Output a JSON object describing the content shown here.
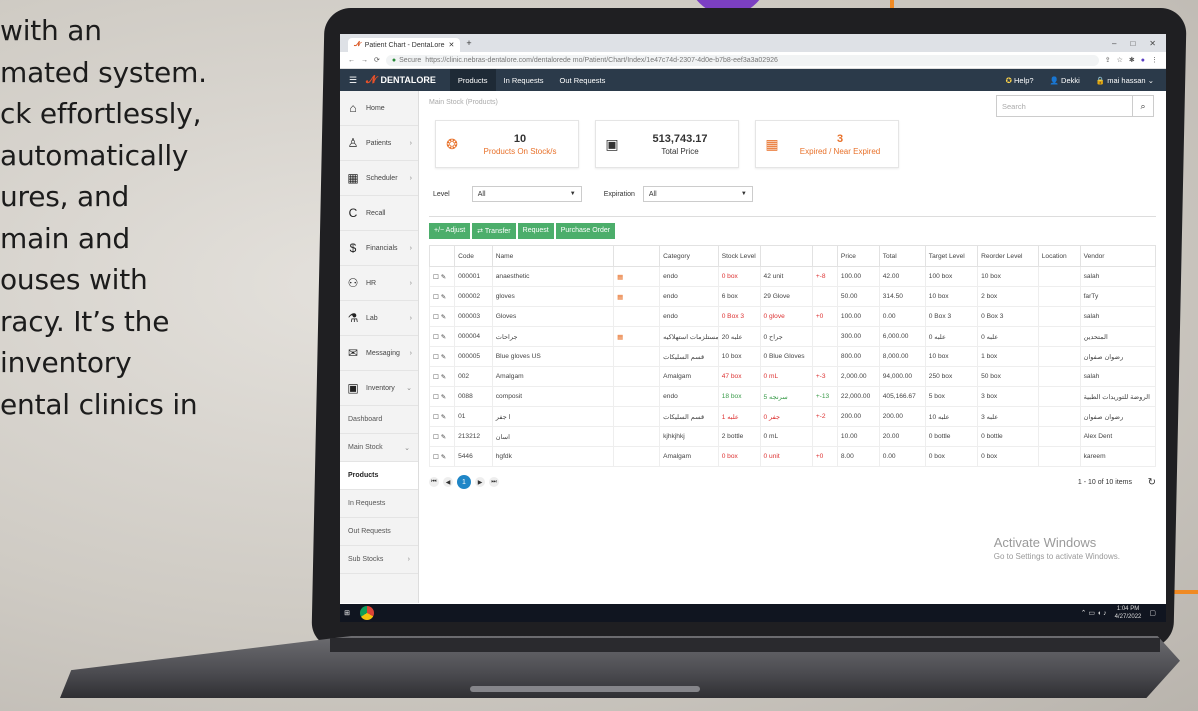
{
  "promo": {
    "lines": [
      "with an",
      "mated system.",
      "ck effortlessly,",
      "automatically",
      "ures, and",
      "main and",
      "ouses with",
      "racy. It’s the",
      "inventory",
      "ental clinics in"
    ]
  },
  "browser": {
    "tab_title": "Patient Chart - DentaLore",
    "new_tab": "+",
    "win_controls": [
      "–",
      "□",
      "✕"
    ],
    "secure": "Secure",
    "url": "https://clinic.nebras-dentalore.com/dentalorede mo/Patient/Chart/Index/1e47c74d-2307-4d0e-b7b8-eef3a3a02926"
  },
  "app": {
    "brand": "DENTALORE",
    "nav": [
      "Products",
      "In Requests",
      "Out Requests"
    ],
    "help": "Help?",
    "user1": "Dekki",
    "user2": "mai hassan",
    "breadcrumb": "Main Stock (Products)",
    "search_placeholder": "Search"
  },
  "sidebar": {
    "items": [
      {
        "label": "Home",
        "icon": "home-icon"
      },
      {
        "label": "Patients",
        "icon": "person-icon"
      },
      {
        "label": "Scheduler",
        "icon": "calendar-icon"
      },
      {
        "label": "Recall",
        "icon": "recall-icon"
      },
      {
        "label": "Financials",
        "icon": "dollar-icon"
      },
      {
        "label": "HR",
        "icon": "group-icon"
      },
      {
        "label": "Lab",
        "icon": "flask-icon"
      },
      {
        "label": "Messaging",
        "icon": "envelope-icon"
      },
      {
        "label": "Inventory",
        "icon": "box-icon"
      }
    ],
    "subitems": [
      "Dashboard",
      "Main Stock",
      "Products",
      "In Requests",
      "Out Requests",
      "Sub Stocks"
    ]
  },
  "cards": [
    {
      "value": "10",
      "label": "Products On Stock/s"
    },
    {
      "value": "513,743.17",
      "label": "Total Price"
    },
    {
      "value": "3",
      "label": "Expired / Near Expired"
    }
  ],
  "filters": {
    "level_label": "Level",
    "level_value": "All",
    "expiration_label": "Expiration",
    "expiration_value": "All"
  },
  "actions": [
    "+/− Adjust",
    "⇄ Transfer",
    "Request",
    "Purchase Order"
  ],
  "table": {
    "headers": [
      "",
      "Code",
      "Name",
      "",
      "Category",
      "Stock Level",
      "",
      "",
      "Price",
      "Total",
      "Target Level",
      "Reorder Level",
      "Location",
      "Vendor"
    ],
    "rows": [
      {
        "code": "000001",
        "name": "anaesthetic",
        "cal": true,
        "category": "endo",
        "s1": "0 box",
        "s2": "42 unit",
        "s3": "+-8",
        "price": "100.00",
        "total": "42.00",
        "target": "100 box",
        "reorder": "10 box",
        "location": "",
        "vendor": "salah"
      },
      {
        "code": "000002",
        "name": "gloves",
        "cal": true,
        "category": "endo",
        "s1": "6 box",
        "s2": "29 Glove",
        "s3": "",
        "price": "50.00",
        "total": "314.50",
        "target": "10 box",
        "reorder": "2 box",
        "location": "",
        "vendor": "farTy"
      },
      {
        "code": "000003",
        "name": "Gloves",
        "cal": false,
        "category": "endo",
        "s1": "0 Box 3",
        "s2": "0 glove",
        "s3": "+0",
        "price": "100.00",
        "total": "0.00",
        "target": "0 Box 3",
        "reorder": "0 Box 3",
        "location": "",
        "vendor": "salah"
      },
      {
        "code": "000004",
        "name": "جراحات",
        "cal": true,
        "category": "مستلزمات استهلاكيه",
        "s1": "20 علبه",
        "s2": "0 جراح",
        "s3": "",
        "price": "300.00",
        "total": "6,000.00",
        "target": "0 علبه",
        "reorder": "0 علبه",
        "location": "",
        "vendor": "المتحدين"
      },
      {
        "code": "000005",
        "name": "Blue gloves US",
        "cal": false,
        "category": "قسم السليكات",
        "s1": "10 box",
        "s2": "0 Blue Gloves",
        "s3": "",
        "price": "800.00",
        "total": "8,000.00",
        "target": "10 box",
        "reorder": "1 box",
        "location": "",
        "vendor": "رضوان صفوان"
      },
      {
        "code": "002",
        "name": "Amalgam",
        "cal": false,
        "category": "Amalgam",
        "s1": "47 box",
        "s2": "0 mL",
        "s3": "+-3",
        "price": "2,000.00",
        "total": "94,000.00",
        "target": "250 box",
        "reorder": "50 box",
        "location": "",
        "vendor": "salah"
      },
      {
        "code": "0088",
        "name": "composit",
        "cal": false,
        "category": "endo",
        "s1": "18 box",
        "s2": "5 سرنجه",
        "s3": "+-13",
        "price": "22,000.00",
        "total": "405,166.67",
        "target": "5 box",
        "reorder": "3 box",
        "location": "",
        "vendor": "الروضة للتوريدات الطبية"
      },
      {
        "code": "01",
        "name": "ا جفر",
        "cal": false,
        "category": "قسم السليكات",
        "s1": "1 علبه",
        "s2": "0 جفر",
        "s3": "+-2",
        "price": "200.00",
        "total": "200.00",
        "target": "10 علبه",
        "reorder": "3 علبه",
        "location": "",
        "vendor": "رضوان صفوان"
      },
      {
        "code": "213212",
        "name": "اسان",
        "cal": false,
        "category": "kjhkjhkj",
        "s1": "2 bottle",
        "s2": "0 mL",
        "s3": "",
        "price": "10.00",
        "total": "20.00",
        "target": "0 bottle",
        "reorder": "0 bottle",
        "location": "",
        "vendor": "Alex Dent"
      },
      {
        "code": "5446",
        "name": "hgfdk",
        "cal": false,
        "category": "Amalgam",
        "s1": "0 box",
        "s2": "0 unit",
        "s3": "+0",
        "price": "8.00",
        "total": "0.00",
        "target": "0 box",
        "reorder": "0 box",
        "location": "",
        "vendor": "kareem"
      }
    ]
  },
  "pager": {
    "current": "1",
    "info": "1 - 10 of 10 items"
  },
  "activate": {
    "title": "Activate Windows",
    "subtitle": "Go to Settings to activate Windows."
  },
  "taskbar": {
    "time": "1:04 PM",
    "date": "4/27/2022"
  },
  "colors": {
    "accent": "#4cae6b",
    "topbar": "#2b3a4a",
    "orange": "#e8712a",
    "page_blue": "#1f86c7"
  }
}
